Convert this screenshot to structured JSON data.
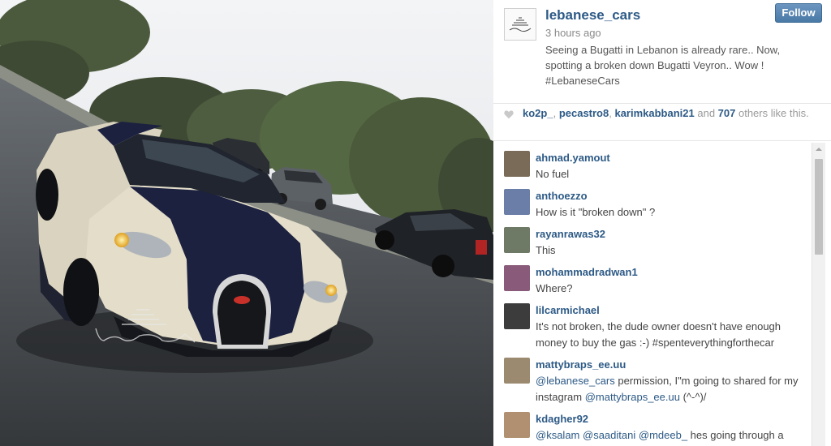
{
  "post": {
    "username": "lebanese_cars",
    "time": "3 hours ago",
    "caption": "Seeing a Bugatti in Lebanon is already rare.. Now, spotting a broken down Bugatti Veyron.. Wow ! #LebaneseCars",
    "follow_label": "Follow",
    "watermark": "Lebanese Cars"
  },
  "likes": {
    "user1": "ko2p_",
    "sep1": ", ",
    "user2": "pecastro8",
    "sep2": ", ",
    "user3": "karimkabbani21",
    "and": " and ",
    "count": "707",
    "tail": " others like this."
  },
  "comments": [
    {
      "user": "ahmad.yamout",
      "text": "No fuel",
      "avatar_color": "#7a6a58"
    },
    {
      "user": "anthoezzo",
      "text": "How is it \"broken down\" ?",
      "avatar_color": "#6b7ea8"
    },
    {
      "user": "rayanrawas32",
      "text": "This",
      "avatar_color": "#6f7a66"
    },
    {
      "user": "mohammadradwan1",
      "text": "Where?",
      "avatar_color": "#8a5a7a"
    },
    {
      "user": "lilcarmichael",
      "text": "It's not broken, the dude owner doesn't have enough money to buy the gas :-) #spenteverythingforthecar",
      "avatar_color": "#3c3c3c"
    },
    {
      "user": "mattybraps_ee.uu",
      "text_parts": [
        "@lebanese_cars",
        " permission, I\"m going to shared for my instagram ",
        "@mattybraps_ee.uu",
        " (^-^)/"
      ],
      "avatar_color": "#9c8a70"
    },
    {
      "user": "kdagher92",
      "text_parts": [
        "@ksalam",
        " ",
        "@saaditani",
        " ",
        "@mdeeb_",
        " hes going through a"
      ],
      "avatar_color": "#b09070"
    }
  ],
  "colors": {
    "link": "#2d5a86",
    "follow_button": "#4a79a6"
  },
  "icons": {
    "likes": "heart-icon",
    "scroll": "scroll-up-arrow-icon"
  }
}
